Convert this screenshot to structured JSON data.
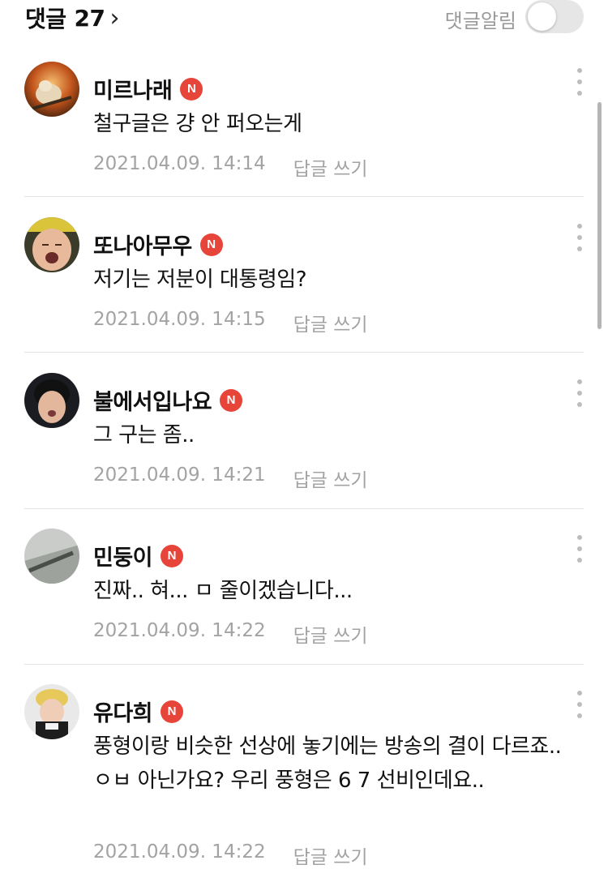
{
  "header": {
    "title": "댓글",
    "count": "27",
    "chevron": "›",
    "notify_label": "댓글알림",
    "notify_on": false
  },
  "badge_label": "N",
  "comments": [
    {
      "nick": "미르나래",
      "text": "철구글은 걍 안 퍼오는게",
      "date": "2021.04.09. 14:14",
      "reply": "답글 쓰기"
    },
    {
      "nick": "또나아무우",
      "text": "저기는 저분이 대통령임?",
      "date": "2021.04.09. 14:15",
      "reply": "답글 쓰기"
    },
    {
      "nick": "불에서입나요",
      "text": "그 구는 좀..",
      "date": "2021.04.09. 14:21",
      "reply": "답글 쓰기"
    },
    {
      "nick": "민둥이",
      "text": "진짜.. 혀... ㅁ 줄이겠습니다...",
      "date": "2021.04.09. 14:22",
      "reply": "답글 쓰기"
    },
    {
      "nick": "유다희",
      "text": "풍형이랑 비슷한 선상에 놓기에는 방송의 결이 다르죠.. ㅇㅂ 아닌가요? 우리 풍형은 6 7 선비인데요..",
      "date": "2021.04.09. 14:22",
      "reply": "답글 쓰기"
    }
  ]
}
